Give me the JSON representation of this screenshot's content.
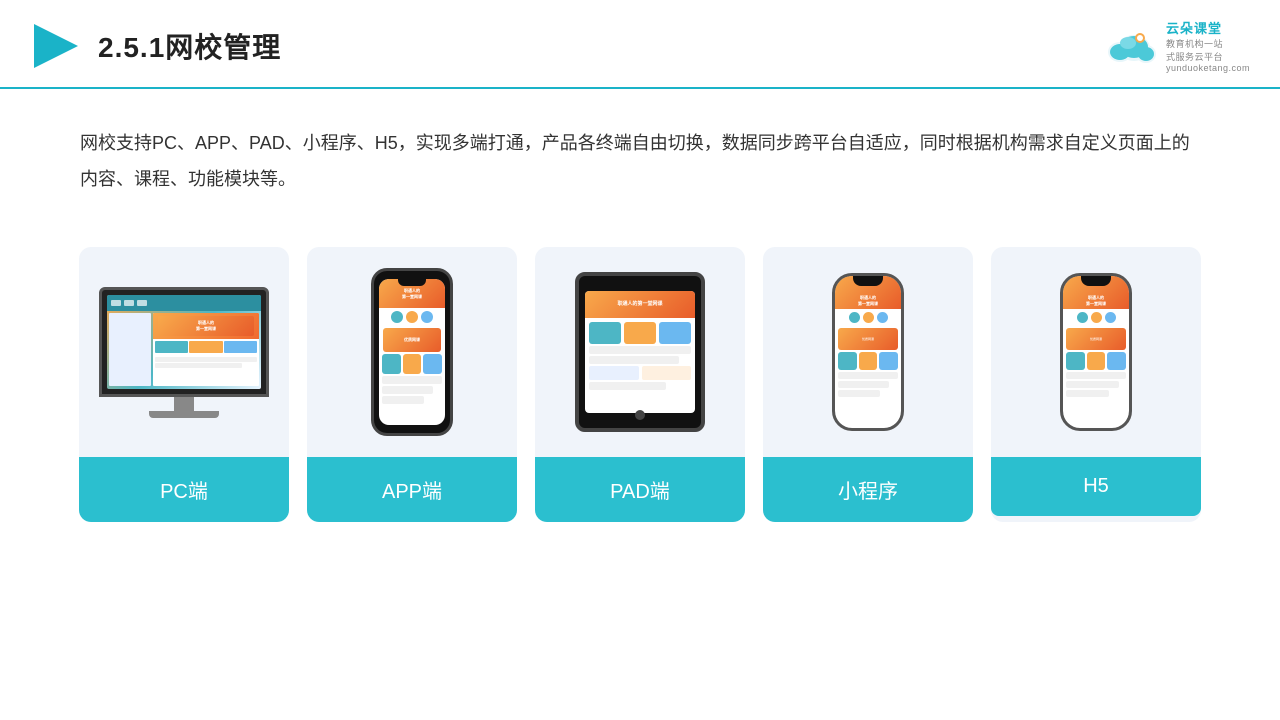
{
  "header": {
    "title": "2.5.1网校管理",
    "logo_name": "云朵课堂",
    "logo_sub_line1": "教育机构一站",
    "logo_sub_line2": "式服务云平台",
    "logo_url": "yunduoketang.com"
  },
  "description": {
    "text": "网校支持PC、APP、PAD、小程序、H5，实现多端打通，产品各终端自由切换，数据同步跨平台自适应，同时根据机构需求自定义页面上的内容、课程、功能模块等。"
  },
  "cards": [
    {
      "id": "pc",
      "label": "PC端"
    },
    {
      "id": "app",
      "label": "APP端"
    },
    {
      "id": "pad",
      "label": "PAD端"
    },
    {
      "id": "miniprogram",
      "label": "小程序"
    },
    {
      "id": "h5",
      "label": "H5"
    }
  ],
  "colors": {
    "accent": "#2bbfcf",
    "header_line": "#1ab3c8",
    "card_bg": "#f0f4fa",
    "label_bg": "#2bbfcf"
  }
}
